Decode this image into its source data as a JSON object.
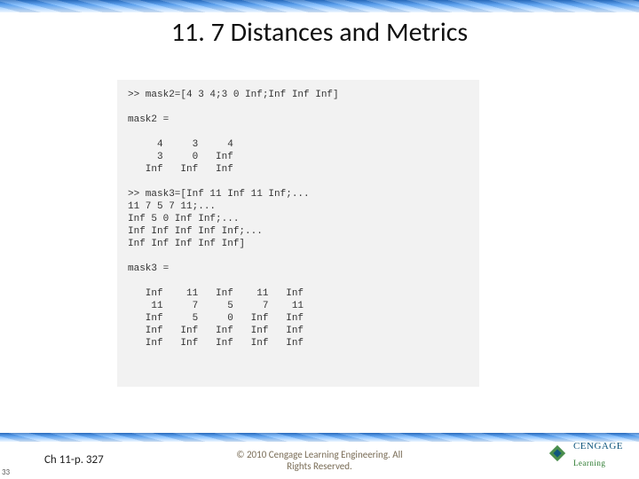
{
  "title": "11. 7 Distances and Metrics",
  "code": ">> mask2=[4 3 4;3 0 Inf;Inf Inf Inf]\n\nmask2 =\n\n     4     3     4\n     3     0   Inf\n   Inf   Inf   Inf\n\n>> mask3=[Inf 11 Inf 11 Inf;...\n11 7 5 7 11;...\nInf 5 0 Inf Inf;...\nInf Inf Inf Inf Inf;...\nInf Inf Inf Inf Inf]\n\nmask3 =\n\n   Inf    11   Inf    11   Inf\n    11     7     5     7    11\n   Inf     5     0   Inf   Inf\n   Inf   Inf   Inf   Inf   Inf\n   Inf   Inf   Inf   Inf   Inf",
  "page_ref": "Ch 11-p. 327",
  "slide_number": "33",
  "copyright_line1": "© 2010 Cengage Learning Engineering. All",
  "copyright_line2": "Rights Reserved.",
  "brand": {
    "line1": "CENGAGE",
    "line2": "Learning"
  }
}
